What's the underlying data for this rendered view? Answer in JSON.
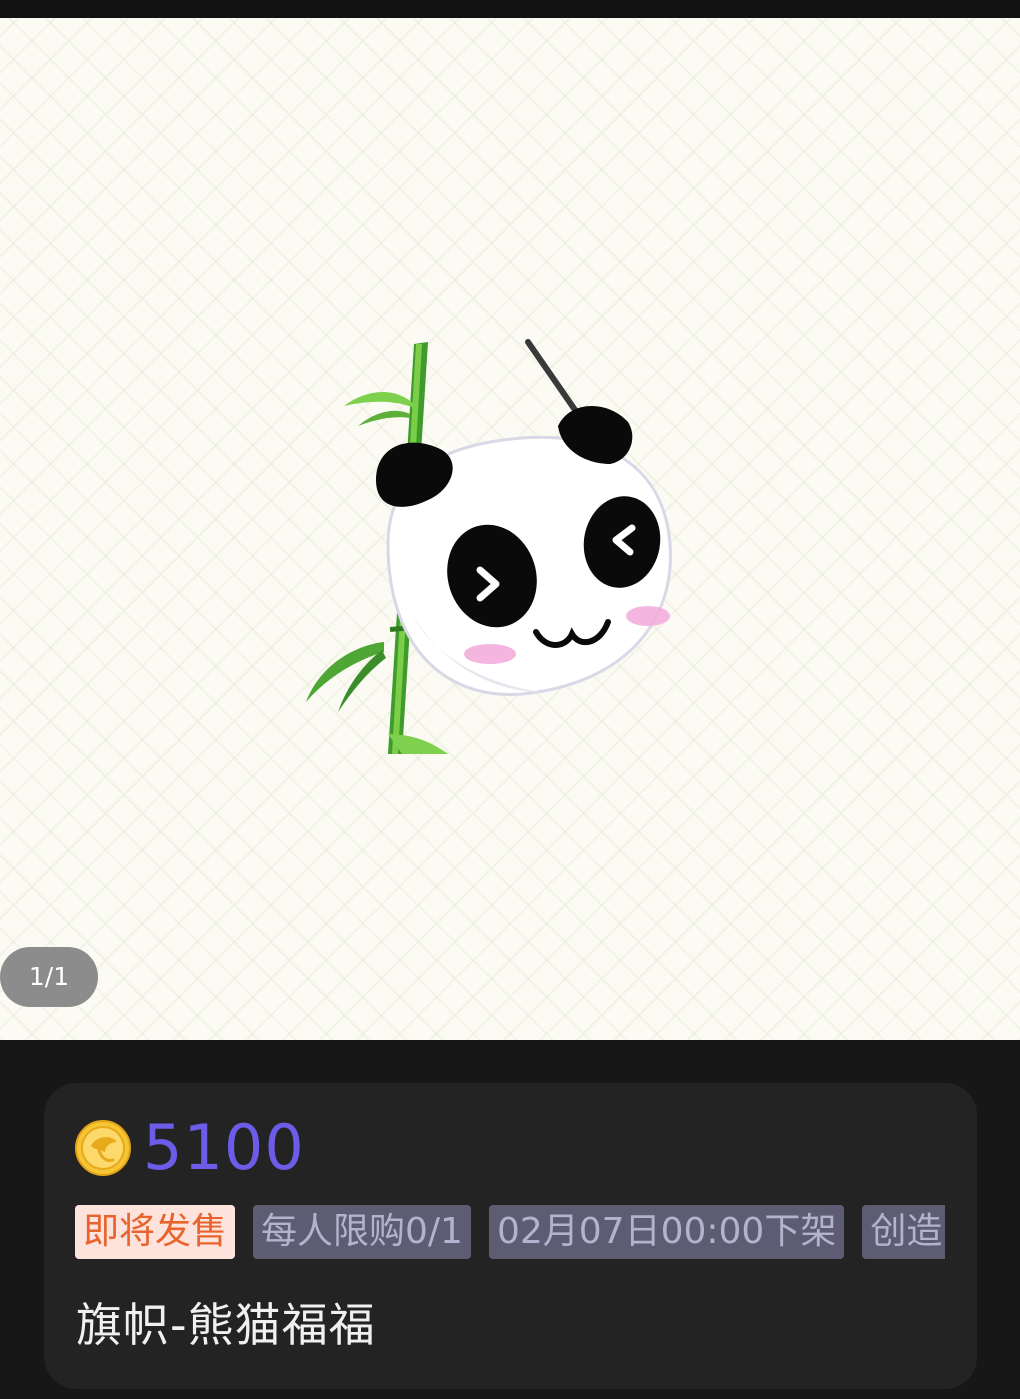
{
  "gallery": {
    "page_indicator": "1/1",
    "image_subject": "panda-flag-icon"
  },
  "product": {
    "currency_icon": "gold-coin-icon",
    "price": "5100",
    "tags": [
      {
        "label": "即将发售",
        "style": "presale"
      },
      {
        "label": "每人限购0/1",
        "style": "gray"
      },
      {
        "label": "02月07日00:00下架",
        "style": "gray"
      },
      {
        "label": "创造",
        "style": "gray"
      }
    ],
    "name": "旗帜-熊猫福福"
  },
  "colors": {
    "price": "#6d5ce8",
    "presale_tag_bg": "#fde3db",
    "presale_tag_text": "#e8632e",
    "gray_tag_bg": "#5d5c72",
    "gray_tag_text": "#b3b2cf",
    "card_bg": "#232323",
    "page_bg": "#171717"
  }
}
